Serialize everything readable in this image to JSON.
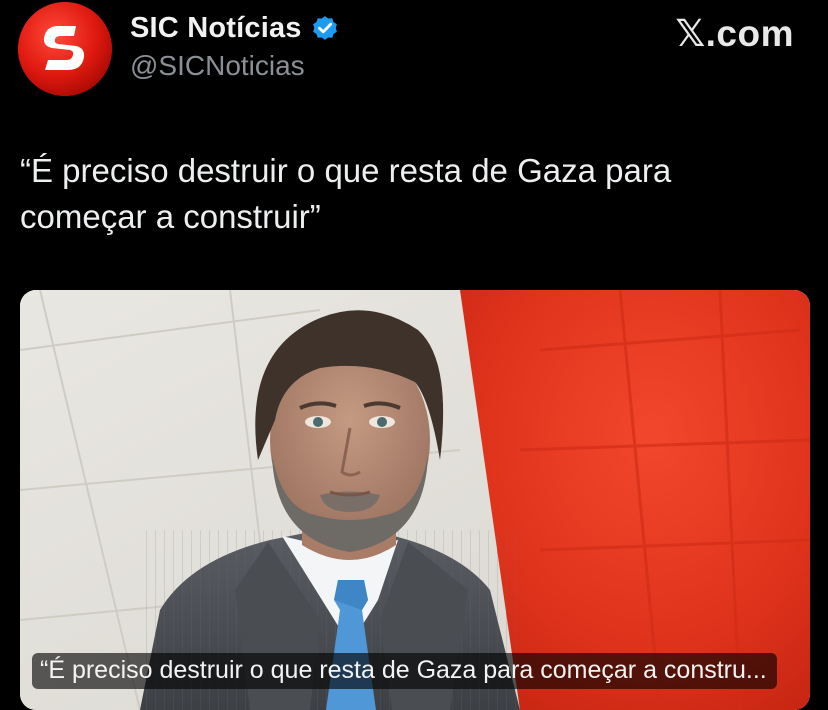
{
  "account": {
    "display_name": "SIC Notícias",
    "handle": "@SICNoticias",
    "verified": true,
    "avatar_icon": "sic-logo-icon",
    "avatar_color": "#e1190f"
  },
  "brand": {
    "label": ".com",
    "glyph": "𝕏"
  },
  "tweet": {
    "text": "“É preciso destruir o que resta de Gaza para começar a construir”"
  },
  "media": {
    "caption": "“É preciso destruir o que resta de Gaza para começar a constru..."
  },
  "colors": {
    "background": "#000000",
    "verified_badge": "#1d9bf0",
    "accent_red": "#e02a1c"
  }
}
